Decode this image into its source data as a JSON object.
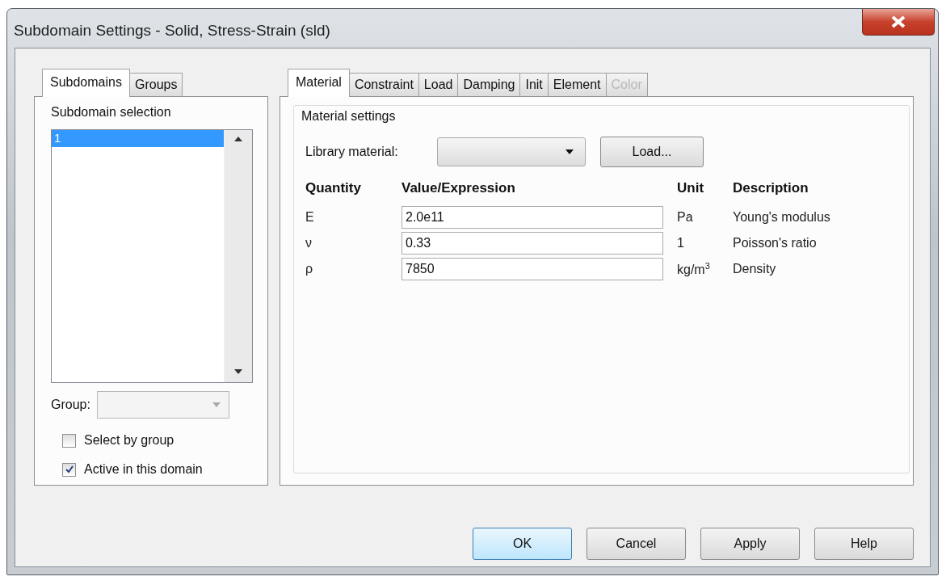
{
  "window": {
    "title": "Subdomain Settings - Solid, Stress-Strain (sld)"
  },
  "left_tabs": [
    {
      "label": "Subdomains",
      "selected": true
    },
    {
      "label": "Groups",
      "selected": false
    }
  ],
  "subdomain_selection": {
    "title": "Subdomain selection",
    "items": [
      {
        "label": "1",
        "selected": true
      }
    ]
  },
  "group": {
    "label": "Group:"
  },
  "checkboxes": [
    {
      "label": "Select by group",
      "checked": false
    },
    {
      "label": "Active in this domain",
      "checked": true
    }
  ],
  "right_tabs": [
    {
      "label": "Material",
      "selected": true,
      "disabled": false
    },
    {
      "label": "Constraint",
      "selected": false,
      "disabled": false
    },
    {
      "label": "Load",
      "selected": false,
      "disabled": false
    },
    {
      "label": "Damping",
      "selected": false,
      "disabled": false
    },
    {
      "label": "Init",
      "selected": false,
      "disabled": false
    },
    {
      "label": "Element",
      "selected": false,
      "disabled": false
    },
    {
      "label": "Color",
      "selected": false,
      "disabled": true
    }
  ],
  "material_settings": {
    "title": "Material settings",
    "library_label": "Library material:",
    "load_button": "Load...",
    "columns": [
      "Quantity",
      "Value/Expression",
      "Unit",
      "Description"
    ],
    "rows": [
      {
        "quantity": "E",
        "value": "2.0e11",
        "unit": "Pa",
        "description": "Young's modulus"
      },
      {
        "quantity": "ν",
        "value": "0.33",
        "unit": "1",
        "description": "Poisson's ratio"
      },
      {
        "quantity": "ρ",
        "value": "7850",
        "unit": "kg/m$^{3}$",
        "description": "Density"
      }
    ]
  },
  "buttons": [
    {
      "label": "OK",
      "default": true
    },
    {
      "label": "Cancel",
      "default": false
    },
    {
      "label": "Apply",
      "default": false
    },
    {
      "label": "Help",
      "default": false
    }
  ]
}
